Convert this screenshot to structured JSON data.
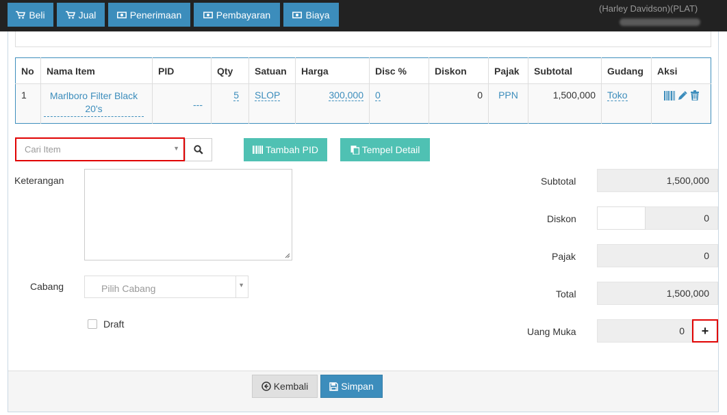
{
  "nav": {
    "buttons": [
      {
        "label": "Beli",
        "icon": "cart-icon"
      },
      {
        "label": "Jual",
        "icon": "cart-icon"
      },
      {
        "label": "Penerimaan",
        "icon": "money-icon"
      },
      {
        "label": "Pembayaran",
        "icon": "money-icon"
      },
      {
        "label": "Biaya",
        "icon": "money-icon"
      }
    ],
    "user": "(Harley Davidson)(PLAT)"
  },
  "table": {
    "headers": [
      "No",
      "Nama Item",
      "PID",
      "Qty",
      "Satuan",
      "Harga",
      "Disc %",
      "Diskon",
      "Pajak",
      "Subtotal",
      "Gudang",
      "Aksi"
    ],
    "rows": [
      {
        "no": "1",
        "nama_item": "Marlboro Filter Black 20's",
        "pid": "---",
        "qty": "5",
        "satuan": "SLOP",
        "harga": "300,000",
        "disc": "0",
        "diskon": "0",
        "pajak": "PPN",
        "subtotal": "1,500,000",
        "gudang": "Toko"
      }
    ]
  },
  "search": {
    "placeholder": "Cari Item",
    "tambah_pid": "Tambah PID",
    "tempel_detail": "Tempel Detail"
  },
  "form": {
    "keterangan_label": "Keterangan",
    "cabang_label": "Cabang",
    "cabang_placeholder": "Pilih Cabang",
    "draft_label": "Draft"
  },
  "totals": {
    "subtotal_label": "Subtotal",
    "subtotal_value": "1,500,000",
    "diskon_label": "Diskon",
    "diskon_value": "0",
    "pajak_label": "Pajak",
    "pajak_value": "0",
    "total_label": "Total",
    "total_value": "1,500,000",
    "uang_muka_label": "Uang Muka",
    "uang_muka_value": "0",
    "plus": "+"
  },
  "footer": {
    "kembali": "Kembali",
    "simpan": "Simpan"
  },
  "colors": {
    "primary": "#3c8dbc",
    "teal": "#4fc1b3",
    "highlight": "#e00000",
    "topbar": "#222222"
  }
}
